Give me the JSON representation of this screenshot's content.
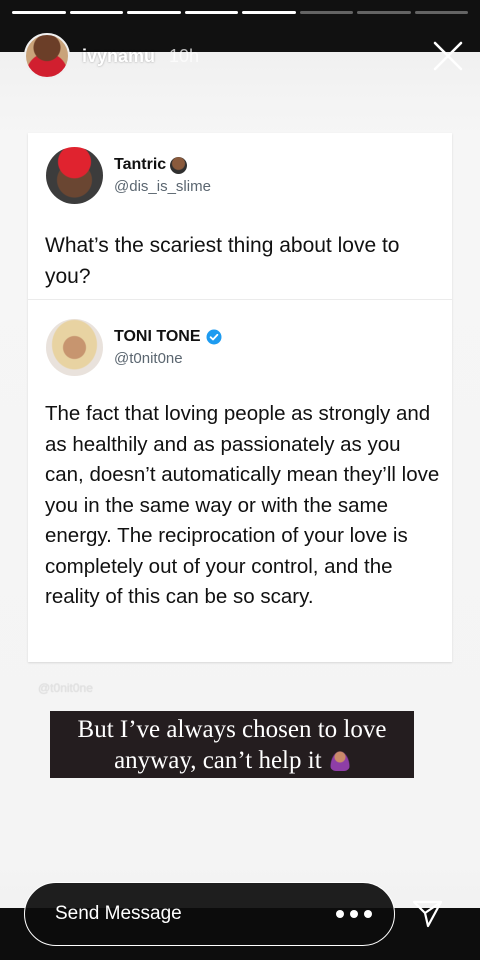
{
  "story": {
    "username": "ivynamu",
    "time_ago": "10h",
    "progress_segments": 8,
    "progress_completed": 5
  },
  "tweet1": {
    "name": "Tantric",
    "handle": "@dis_is_slime",
    "text": "What’s the scariest thing about love to you?"
  },
  "tweet2": {
    "name": "TONI TONE",
    "handle": "@t0nit0ne",
    "verified": true,
    "text": "The fact that loving people as strongly and as healthily and as passionately as you can, doesn’t automatically mean they’ll love you in the same way or with the same energy. The reciprocation of your love is completely out of your control, and the reality of this can be so scary."
  },
  "watermark": "@t0nit0ne",
  "caption": {
    "line1": "But I’ve always chosen to love",
    "line2": "anyway, can’t help it"
  },
  "reply": {
    "placeholder": "Send Message"
  },
  "colors": {
    "verified_blue": "#1d9bf0",
    "caption_bg": "#241d1f"
  }
}
